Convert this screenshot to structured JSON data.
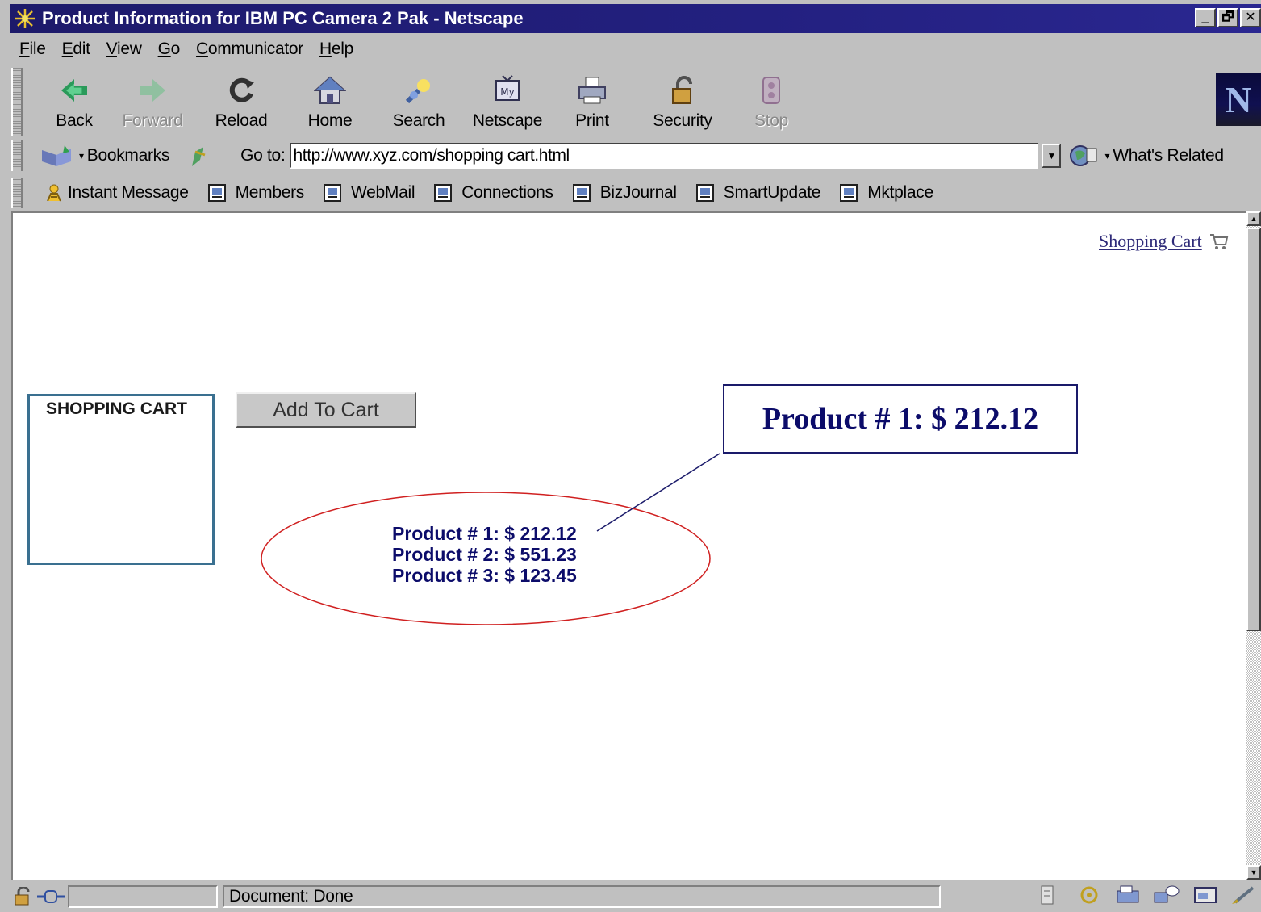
{
  "window": {
    "title": "Product Information for IBM PC Camera 2 Pak - Netscape",
    "controls": {
      "minimize": "_",
      "maximize": "🗗",
      "close": "✕"
    }
  },
  "menu": [
    {
      "label": "File"
    },
    {
      "label": "Edit"
    },
    {
      "label": "View"
    },
    {
      "label": "Go"
    },
    {
      "label": "Communicator"
    },
    {
      "label": "Help"
    }
  ],
  "nav_toolbar": {
    "back": "Back",
    "forward": "Forward",
    "reload": "Reload",
    "home": "Home",
    "search": "Search",
    "netscape": "Netscape",
    "print": "Print",
    "security": "Security",
    "stop": "Stop",
    "logo": "N"
  },
  "location": {
    "bookmarks_label": "Bookmarks",
    "goto_label": "Go to:",
    "url": "http://www.xyz.com/shopping cart.html",
    "whats_related": "What's Related"
  },
  "personal_toolbar": [
    "Instant Message",
    "Members",
    "WebMail",
    "Connections",
    "BizJournal",
    "SmartUpdate",
    "Mktplace"
  ],
  "page": {
    "shopping_cart_link": "Shopping Cart",
    "cart_box_title": "SHOPPING CART",
    "add_to_cart_button": "Add To Cart",
    "callout_text": "Product # 1: $ 212.12",
    "products": [
      "Product # 1: $ 212.12",
      "Product # 2: $ 551.23",
      "Product # 3: $ 123.45"
    ],
    "colors": {
      "product_text": "#0c0c6a",
      "ellipse": "#d02020",
      "cart_border": "#3a7090"
    }
  },
  "status": {
    "text": "Document: Done"
  }
}
